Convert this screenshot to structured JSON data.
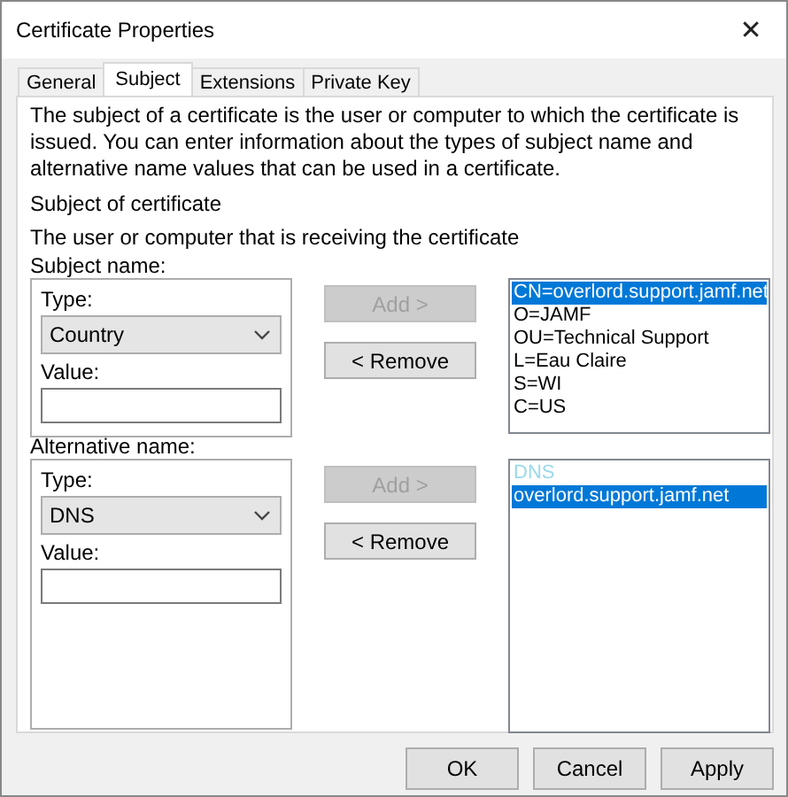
{
  "window": {
    "title": "Certificate Properties",
    "close": "✕"
  },
  "tabs": [
    {
      "label": "General",
      "selected": false
    },
    {
      "label": "Subject",
      "selected": true
    },
    {
      "label": "Extensions",
      "selected": false
    },
    {
      "label": "Private Key",
      "selected": false
    }
  ],
  "description": "The subject of a certificate is the user or computer to which the certificate is issued. You can enter information about the types of subject name and alternative name values that can be used in a certificate.",
  "section_title": "Subject of certificate",
  "section_subtitle": "The user or computer that is receiving the certificate",
  "groups": [
    {
      "label": "Subject name:",
      "type_label": "Type:",
      "type_value": "Country",
      "value_label": "Value:",
      "buttons": [
        {
          "label": "Add >",
          "disabled": true
        },
        {
          "label": "< Remove",
          "disabled": false
        }
      ],
      "list": [
        {
          "text": "CN=overlord.support.jamf.net",
          "kind": "entry",
          "selected": true
        },
        {
          "text": "O=JAMF",
          "kind": "entry",
          "selected": false
        },
        {
          "text": "OU=Technical Support",
          "kind": "entry",
          "selected": false
        },
        {
          "text": "L=Eau Claire",
          "kind": "entry",
          "selected": false
        },
        {
          "text": "S=WI",
          "kind": "entry",
          "selected": false
        },
        {
          "text": "C=US",
          "kind": "entry",
          "selected": false
        }
      ]
    },
    {
      "label": "Alternative name:",
      "type_label": "Type:",
      "type_value": "DNS",
      "value_label": "Value:",
      "buttons": [
        {
          "label": "Add >",
          "disabled": true
        },
        {
          "label": "< Remove",
          "disabled": false
        }
      ],
      "list": [
        {
          "text": "DNS",
          "kind": "header",
          "selected": false
        },
        {
          "text": "overlord.support.jamf.net",
          "kind": "entry",
          "selected": true
        }
      ]
    }
  ],
  "dialog_buttons": [
    "OK",
    "Cancel",
    "Apply"
  ]
}
